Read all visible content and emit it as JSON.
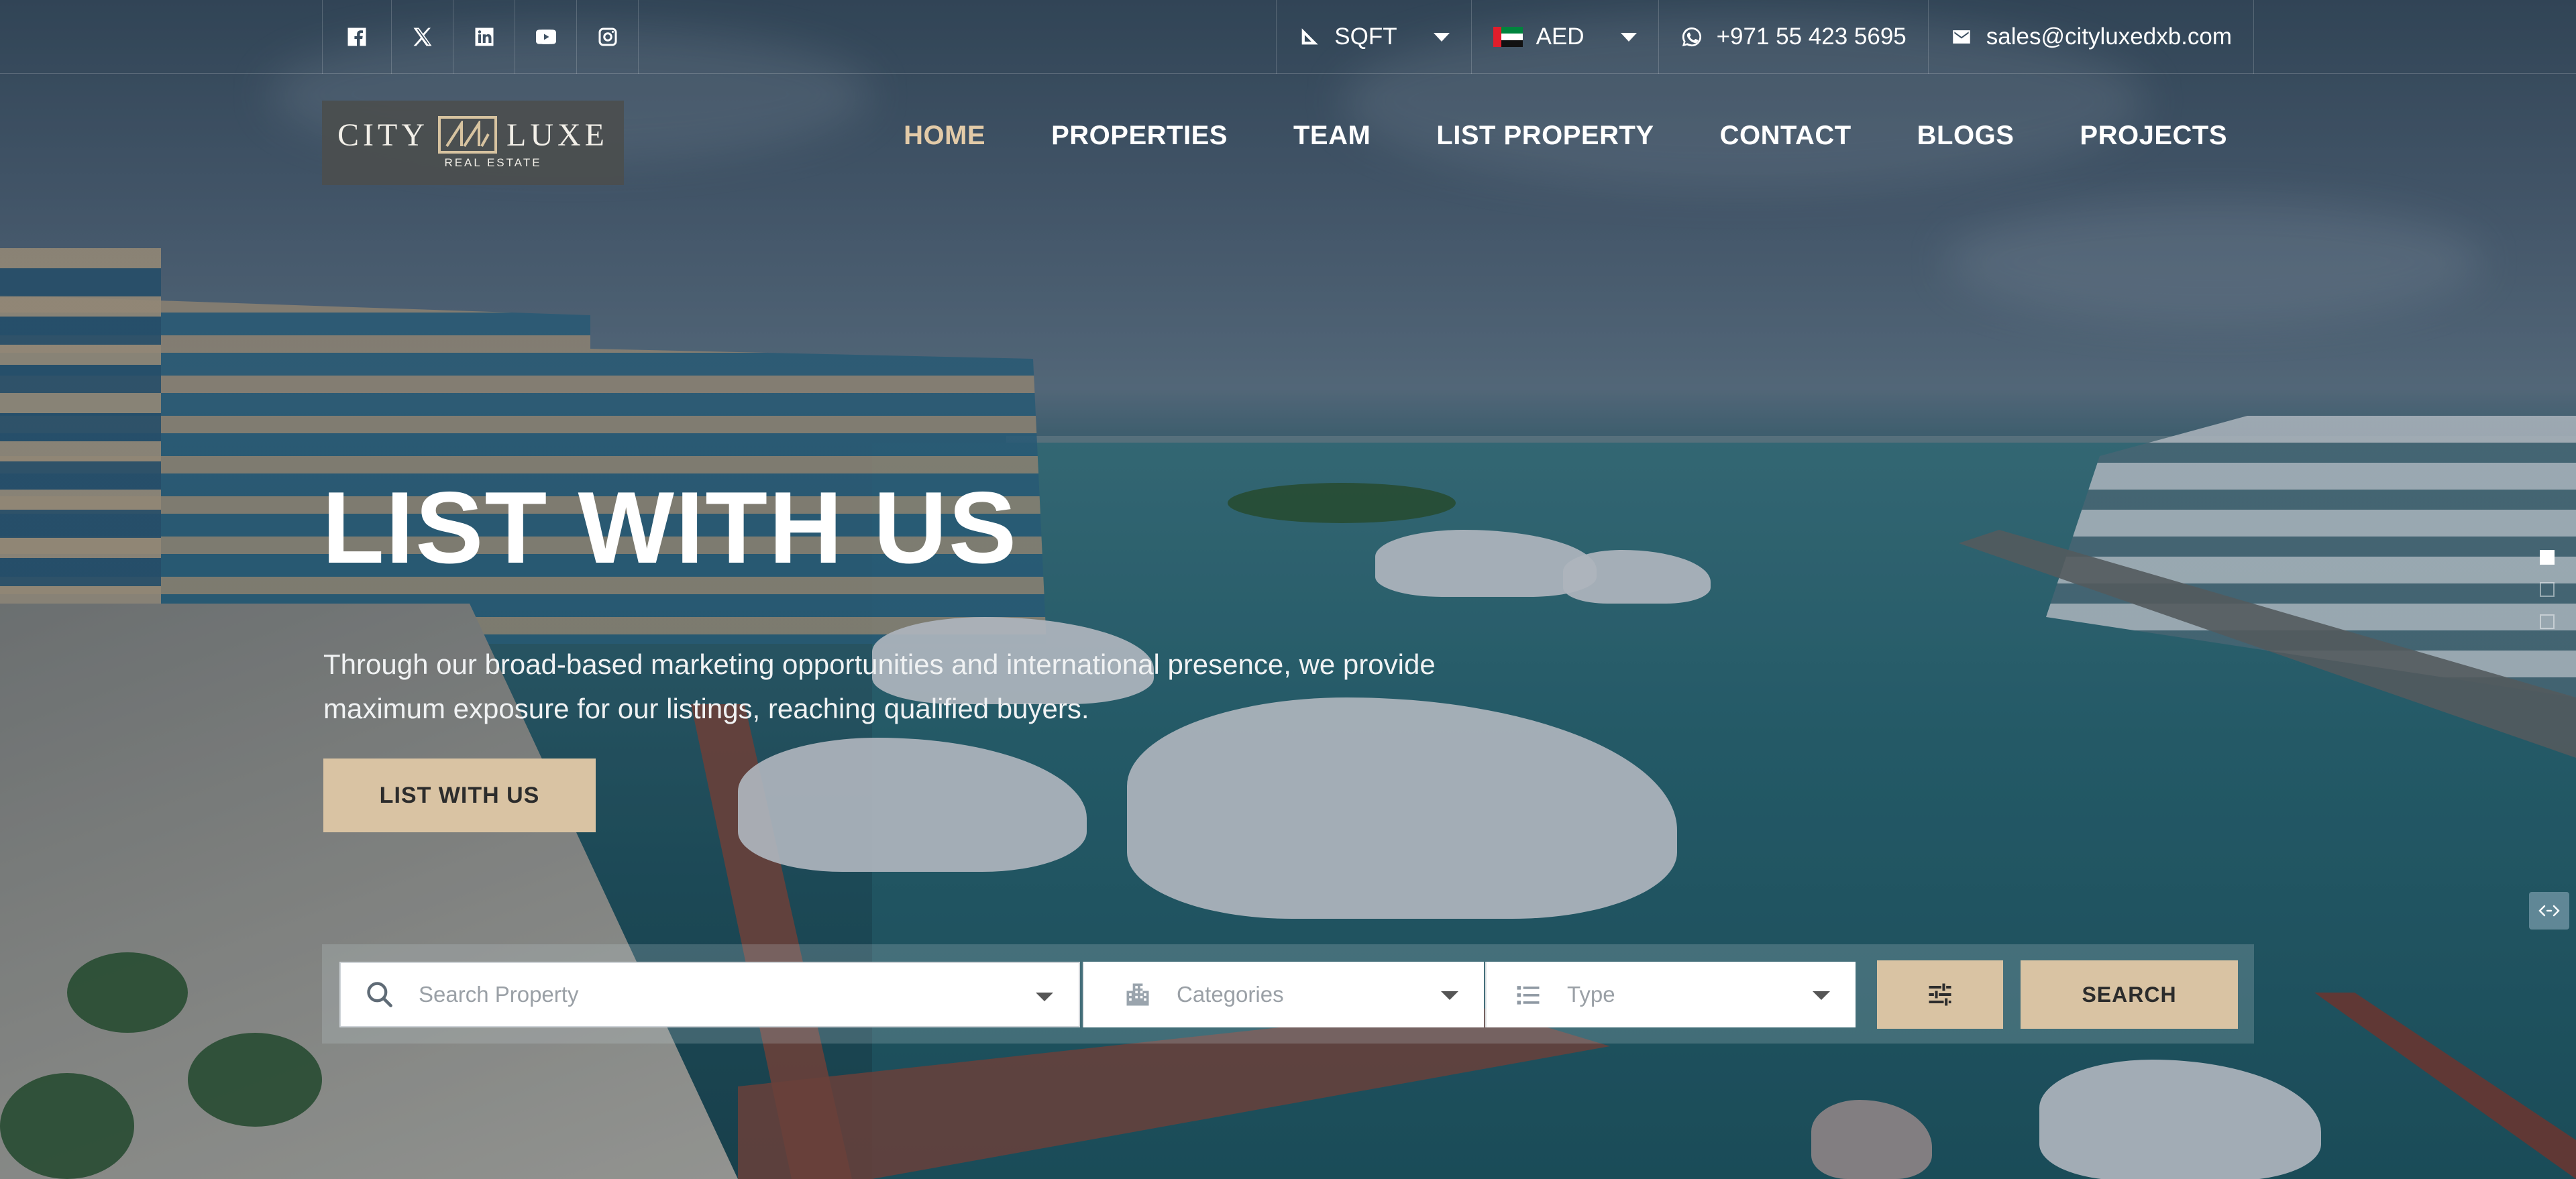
{
  "topbar": {
    "socials": [
      {
        "icon": "facebook-icon"
      },
      {
        "icon": "x-twitter-icon"
      },
      {
        "icon": "linkedin-icon"
      },
      {
        "icon": "youtube-icon"
      },
      {
        "icon": "instagram-icon"
      }
    ],
    "unit_label": "SQFT",
    "currency_label": "AED",
    "phone": "+971 55 423 5695",
    "email": "sales@cityluxedxb.com"
  },
  "brand": {
    "name_left": "CITY",
    "name_right": "LUXE",
    "tagline": "REAL ESTATE"
  },
  "nav": {
    "items": [
      "HOME",
      "PROPERTIES",
      "TEAM",
      "LIST PROPERTY",
      "CONTACT",
      "BLOGS",
      "PROJECTS"
    ],
    "active": "HOME"
  },
  "hero": {
    "title": "LIST WITH US",
    "description": "Through our broad-based marketing opportunities and international presence, we provide maximum exposure for our listings, reaching qualified buyers.",
    "cta_label": "LIST WITH US"
  },
  "search": {
    "property_placeholder": "Search Property",
    "categories_placeholder": "Categories",
    "type_placeholder": "Type",
    "search_label": "SEARCH"
  },
  "colors": {
    "accent": "#d9c3a3",
    "nav_active": "#e3cba8"
  },
  "slider": {
    "slides": 3,
    "active_index": 0
  }
}
